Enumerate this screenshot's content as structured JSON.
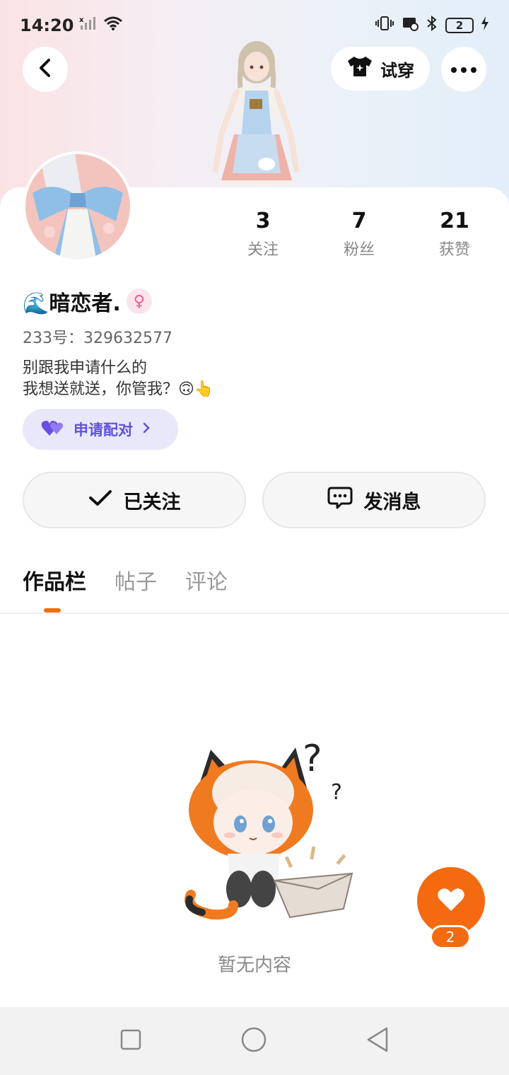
{
  "status_bar": {
    "time": "14:20",
    "battery": "2",
    "icons": [
      "no-signal-icon",
      "wifi-icon",
      "vibrate-icon",
      "notification-icon",
      "bluetooth-icon",
      "battery-icon",
      "charging-icon"
    ]
  },
  "header": {
    "tryon_label": "试穿"
  },
  "profile": {
    "name": "暗恋者.",
    "name_emoji": "🌊",
    "gender_symbol": "♀",
    "uid": "233号：329632577",
    "bio_line1": "别跟我申请什么的",
    "bio_line2": "我想送就送，你管我？🙃👆",
    "pair_label": "申请配对"
  },
  "stats": [
    {
      "value": "3",
      "label": "关注"
    },
    {
      "value": "7",
      "label": "粉丝"
    },
    {
      "value": "21",
      "label": "获赞"
    }
  ],
  "actions": {
    "follow_label": "已关注",
    "message_label": "发消息"
  },
  "tabs": [
    {
      "label": "作品栏",
      "active": true
    },
    {
      "label": "帖子",
      "active": false
    },
    {
      "label": "评论",
      "active": false
    }
  ],
  "empty": {
    "text": "暂无内容"
  },
  "fab": {
    "count": "2"
  },
  "colors": {
    "accent": "#f46a10",
    "pair_bg": "#e9e8fb",
    "pair_text": "#6052d8"
  }
}
